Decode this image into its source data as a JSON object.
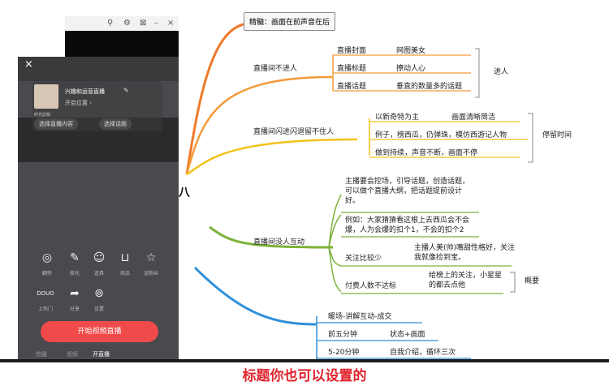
{
  "mindmap": {
    "root_fragment": "留人八",
    "top_box": "精髓：画面在前声音在后",
    "b1": {
      "label": "直播间不进人",
      "items": [
        {
          "left": "直播封面",
          "right": "网图美女"
        },
        {
          "left": "直播标题",
          "right": "撩动人心"
        },
        {
          "left": "直播话题",
          "right": "垂直的数量多的话题"
        }
      ],
      "summary": "进人"
    },
    "b2": {
      "label": "直播间闪进闪退留不住人",
      "items": [
        {
          "left": "以新奇特为主",
          "right": "画面清晰简洁"
        },
        {
          "left": "例子，榜西瓜，仍弹珠，模仿西游记人物",
          "right": ""
        },
        {
          "left": "做到持续，声音不断，画面不停",
          "right": ""
        }
      ],
      "summary": "停留时间"
    },
    "b3": {
      "label": "直播间没人互动",
      "items": [
        {
          "text": "主播要会控场，引导话题，创造话题，可以做个直播大纲，把话题提前设计好。"
        },
        {
          "text": "例如：大家猜猜看这根上去西瓜会不会爆，人为会爆的扣个1，不会的扣个2"
        },
        {
          "left": "关注比较少",
          "right": "主播人美(帅)嘴甜性格好，关注我就像捡到宝。"
        },
        {
          "left": "付费人数不达标",
          "right": "给榜上的关注，小星星的都去点他"
        }
      ],
      "summary": "概要"
    },
    "b4": {
      "label": "",
      "items": [
        {
          "text": "暖场-讲解互动-成交"
        },
        {
          "left": "前五分钟",
          "right": "状态+画面"
        },
        {
          "left": "5-20分钟",
          "right": "自我介绍，循环三次"
        }
      ]
    }
  },
  "window": {
    "icons": [
      "pin-icon",
      "settings-icon",
      "crop-icon",
      "minimize-icon",
      "close-icon"
    ],
    "glyphs": [
      "⚲",
      "⚙",
      "⊠",
      "–",
      "×"
    ]
  },
  "phone": {
    "close_glyph": "×",
    "room_title": "兴趣和运营直播",
    "edit_glyph": "✎",
    "location": "开启位置 ›",
    "anchor": "时光剪辑",
    "pill1": "选择直播内容",
    "pill2": "选择话题",
    "tools": [
      {
        "glyph": "◎",
        "label": "翻转"
      },
      {
        "glyph": "✎",
        "label": "美化"
      },
      {
        "glyph": "☺",
        "label": "道具"
      },
      {
        "glyph": "⊔",
        "label": "商品"
      },
      {
        "glyph": "☆",
        "label": "送粉丝"
      }
    ],
    "tools2": [
      {
        "glyph": "DOUO",
        "label": "上热门"
      },
      {
        "glyph": "➦",
        "label": "分享"
      },
      {
        "glyph": "⊚",
        "label": "设置"
      }
    ],
    "start_button": "开始视频直播",
    "bottom_tabs": [
      "拍摄",
      "视频",
      "开直播"
    ]
  },
  "subtitle": "标题你也可以设置的",
  "colors": {
    "orange": "#f07a2a",
    "yellow": "#f2c21b",
    "green": "#7bb23a",
    "blue": "#2e8fd8",
    "red": "#e0232c",
    "live_btn": "#f04a4a"
  }
}
